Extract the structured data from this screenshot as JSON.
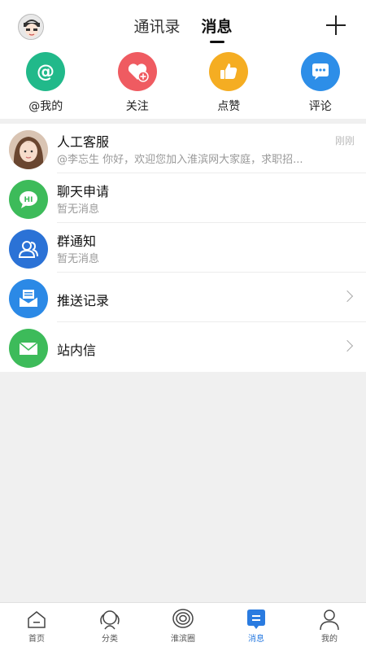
{
  "header": {
    "tabs": [
      {
        "label": "通讯录",
        "active": false
      },
      {
        "label": "消息",
        "active": true
      }
    ]
  },
  "quick_actions": [
    {
      "label": "@我的",
      "icon": "at-icon",
      "color": "#21b98a"
    },
    {
      "label": "关注",
      "icon": "heart-plus-icon",
      "color": "#ef5b61"
    },
    {
      "label": "点赞",
      "icon": "thumbs-up-icon",
      "color": "#f5ad22"
    },
    {
      "label": "评论",
      "icon": "comment-icon",
      "color": "#2d8ee8"
    }
  ],
  "messages": [
    {
      "title": "人工客服",
      "subtitle": "@李忘生  你好，欢迎您加入淮滨网大家庭，求职招...",
      "time": "刚刚",
      "icon": "service-avatar"
    },
    {
      "title": "聊天申请",
      "subtitle": "暂无消息",
      "icon": "chat-request-icon",
      "color": "#3dbb5a"
    },
    {
      "title": "群通知",
      "subtitle": "暂无消息",
      "icon": "group-icon",
      "color": "#2b72d6"
    },
    {
      "title": "推送记录",
      "icon": "push-record-icon",
      "color": "#2b89e6"
    },
    {
      "title": "站内信",
      "icon": "mail-icon",
      "color": "#3dbb5a"
    }
  ],
  "bottom_nav": [
    {
      "label": "首页",
      "icon": "home-icon",
      "active": false
    },
    {
      "label": "分类",
      "icon": "category-icon",
      "active": false
    },
    {
      "label": "淮滨圈",
      "icon": "circle-icon",
      "active": false
    },
    {
      "label": "消息",
      "icon": "message-icon",
      "active": true
    },
    {
      "label": "我的",
      "icon": "profile-icon",
      "active": false
    }
  ]
}
